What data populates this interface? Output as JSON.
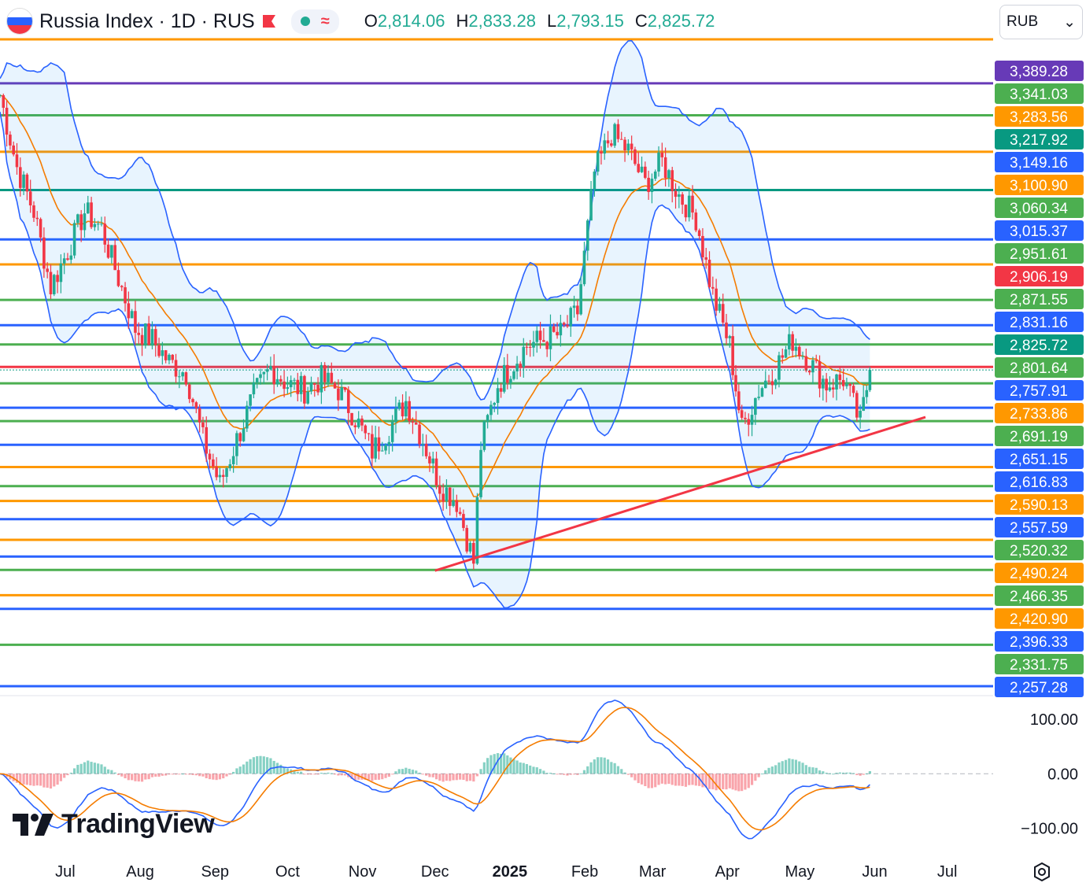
{
  "header": {
    "symbol_title": "Russia Index · 1D · RUS",
    "open_key": "O",
    "open": "2,814.06",
    "high_key": "H",
    "high": "2,833.28",
    "low_key": "L",
    "low": "2,793.15",
    "close_key": "C",
    "close": "2,825.72",
    "flag_icon": "russia-flag-icon",
    "indicator_dot_color": "#22ab94"
  },
  "currency_select": {
    "value": "RUB",
    "chevron": "⌄"
  },
  "logo": {
    "text": "TradingView"
  },
  "colors": {
    "up": "#22ab94",
    "down": "#f23645",
    "band": "#2962ff",
    "ema": "#f57c00",
    "trend": "#f23645",
    "macd": "#2962ff",
    "signal": "#f57c00"
  },
  "chart_data": {
    "type": "candlestick",
    "symbol": "Russia Index",
    "interval": "1D",
    "exchange": "RUS",
    "x_ticks": [
      {
        "label": "Jul",
        "date": "2024-07-01"
      },
      {
        "label": "Aug",
        "date": "2024-08-01"
      },
      {
        "label": "Sep",
        "date": "2024-09-01"
      },
      {
        "label": "Oct",
        "date": "2024-10-01"
      },
      {
        "label": "Nov",
        "date": "2024-11-01"
      },
      {
        "label": "Dec",
        "date": "2024-12-01"
      },
      {
        "label": "2025",
        "date": "2025-01-01",
        "bold": true
      },
      {
        "label": "Feb",
        "date": "2025-02-01"
      },
      {
        "label": "Mar",
        "date": "2025-03-01"
      },
      {
        "label": "Apr",
        "date": "2025-04-01"
      },
      {
        "label": "May",
        "date": "2025-05-01"
      },
      {
        "label": "Jun",
        "date": "2025-06-01"
      },
      {
        "label": "Jul",
        "date": "2025-07-01"
      }
    ],
    "x_range": [
      "2024-06-04",
      "2025-07-20"
    ],
    "y_range": [
      2257.28,
      3420
    ],
    "close_series": [
      [
        "2024-06-04",
        3320
      ],
      [
        "2024-06-11",
        3190
      ],
      [
        "2024-06-18",
        3110
      ],
      [
        "2024-06-25",
        2975
      ],
      [
        "2024-07-02",
        3040
      ],
      [
        "2024-07-09",
        3110
      ],
      [
        "2024-07-16",
        3080
      ],
      [
        "2024-07-23",
        2990
      ],
      [
        "2024-07-30",
        2900
      ],
      [
        "2024-08-06",
        2880
      ],
      [
        "2024-08-13",
        2840
      ],
      [
        "2024-08-20",
        2820
      ],
      [
        "2024-08-27",
        2700
      ],
      [
        "2024-09-03",
        2620
      ],
      [
        "2024-09-10",
        2700
      ],
      [
        "2024-09-17",
        2780
      ],
      [
        "2024-09-24",
        2830
      ],
      [
        "2024-10-01",
        2800
      ],
      [
        "2024-10-08",
        2790
      ],
      [
        "2024-10-15",
        2810
      ],
      [
        "2024-10-22",
        2790
      ],
      [
        "2024-10-29",
        2740
      ],
      [
        "2024-11-05",
        2680
      ],
      [
        "2024-11-12",
        2720
      ],
      [
        "2024-11-19",
        2770
      ],
      [
        "2024-11-26",
        2700
      ],
      [
        "2024-12-03",
        2620
      ],
      [
        "2024-12-10",
        2590
      ],
      [
        "2024-12-17",
        2480
      ],
      [
        "2024-12-20",
        2690
      ],
      [
        "2024-12-27",
        2800
      ],
      [
        "2025-01-08",
        2870
      ],
      [
        "2025-01-15",
        2880
      ],
      [
        "2025-01-22",
        2890
      ],
      [
        "2025-01-29",
        2930
      ],
      [
        "2025-02-05",
        3180
      ],
      [
        "2025-02-12",
        3250
      ],
      [
        "2025-02-19",
        3220
      ],
      [
        "2025-02-26",
        3160
      ],
      [
        "2025-03-05",
        3200
      ],
      [
        "2025-03-12",
        3140
      ],
      [
        "2025-03-19",
        3100
      ],
      [
        "2025-03-26",
        2960
      ],
      [
        "2025-04-02",
        2870
      ],
      [
        "2025-04-07",
        2720
      ],
      [
        "2025-04-14",
        2790
      ],
      [
        "2025-04-21",
        2830
      ],
      [
        "2025-04-28",
        2880
      ],
      [
        "2025-05-05",
        2840
      ],
      [
        "2025-05-12",
        2800
      ],
      [
        "2025-05-19",
        2810
      ],
      [
        "2025-05-26",
        2730
      ],
      [
        "2025-05-30",
        2825.72
      ]
    ],
    "ohlc_last": {
      "open": 2814.06,
      "high": 2833.28,
      "low": 2793.15,
      "close": 2825.72
    },
    "trendline": [
      [
        "2024-12-01",
        2465
      ],
      [
        "2025-06-22",
        2741
      ]
    ],
    "horizontal_levels": [
      {
        "value": 3420,
        "color": "#ff9800"
      },
      {
        "value": 3341.03,
        "color": "#673ab7"
      },
      {
        "value": 3283.56,
        "color": "#4caf50"
      },
      {
        "value": 3217.92,
        "color": "#ff9800"
      },
      {
        "value": 3149.16,
        "color": "#089981"
      },
      {
        "value": 3060.34,
        "color": "#2962ff"
      },
      {
        "value": 3015.37,
        "color": "#ff9800"
      },
      {
        "value": 2951.61,
        "color": "#4caf50"
      },
      {
        "value": 2906.19,
        "color": "#2962ff"
      },
      {
        "value": 2871.55,
        "color": "#4caf50"
      },
      {
        "value": 2831.16,
        "color": "#f23645"
      },
      {
        "value": 2801.64,
        "color": "#4caf50"
      },
      {
        "value": 2757.91,
        "color": "#2962ff"
      },
      {
        "value": 2733.86,
        "color": "#4caf50"
      },
      {
        "value": 2691.19,
        "color": "#2962ff"
      },
      {
        "value": 2651.15,
        "color": "#ff9800"
      },
      {
        "value": 2616.83,
        "color": "#4caf50"
      },
      {
        "value": 2590.13,
        "color": "#ff9800"
      },
      {
        "value": 2557.59,
        "color": "#2962ff"
      },
      {
        "value": 2520.32,
        "color": "#ff9800"
      },
      {
        "value": 2490.24,
        "color": "#2962ff"
      },
      {
        "value": 2466.35,
        "color": "#4caf50"
      },
      {
        "value": 2420.9,
        "color": "#ff9800"
      },
      {
        "value": 2396.33,
        "color": "#2962ff"
      },
      {
        "value": 2331.75,
        "color": "#4caf50"
      },
      {
        "value": 2257.28,
        "color": "#2962ff"
      }
    ],
    "price_labels": [
      {
        "text": "3,389.28",
        "bg": "#673ab7"
      },
      {
        "text": "3,341.03",
        "bg": "#4caf50"
      },
      {
        "text": "3,283.56",
        "bg": "#ff9800"
      },
      {
        "text": "3,217.92",
        "bg": "#089981"
      },
      {
        "text": "3,149.16",
        "bg": "#2962ff"
      },
      {
        "text": "3,100.90",
        "bg": "#ff9800"
      },
      {
        "text": "3,060.34",
        "bg": "#4caf50"
      },
      {
        "text": "3,015.37",
        "bg": "#2962ff"
      },
      {
        "text": "2,951.61",
        "bg": "#4caf50"
      },
      {
        "text": "2,906.19",
        "bg": "#f23645"
      },
      {
        "text": "2,871.55",
        "bg": "#4caf50"
      },
      {
        "text": "2,831.16",
        "bg": "#2962ff"
      },
      {
        "text": "2,825.72",
        "bg": "#089981"
      },
      {
        "text": "2,801.64",
        "bg": "#4caf50"
      },
      {
        "text": "2,757.91",
        "bg": "#2962ff"
      },
      {
        "text": "2,733.86",
        "bg": "#ff9800"
      },
      {
        "text": "2,691.19",
        "bg": "#4caf50"
      },
      {
        "text": "2,651.15",
        "bg": "#2962ff"
      },
      {
        "text": "2,616.83",
        "bg": "#2962ff"
      },
      {
        "text": "2,590.13",
        "bg": "#ff9800"
      },
      {
        "text": "2,557.59",
        "bg": "#2962ff"
      },
      {
        "text": "2,520.32",
        "bg": "#4caf50"
      },
      {
        "text": "2,490.24",
        "bg": "#ff9800"
      },
      {
        "text": "2,466.35",
        "bg": "#4caf50"
      },
      {
        "text": "2,420.90",
        "bg": "#ff9800"
      },
      {
        "text": "2,396.33",
        "bg": "#2962ff"
      },
      {
        "text": "2,331.75",
        "bg": "#4caf50"
      },
      {
        "text": "2,257.28",
        "bg": "#2962ff"
      }
    ],
    "indicator": {
      "name": "MACD",
      "y_ticks": [
        "100.00",
        "0.00",
        "−100.00"
      ],
      "y_values": [
        100,
        0,
        -100
      ],
      "y_range": [
        -125,
        120
      ]
    }
  }
}
